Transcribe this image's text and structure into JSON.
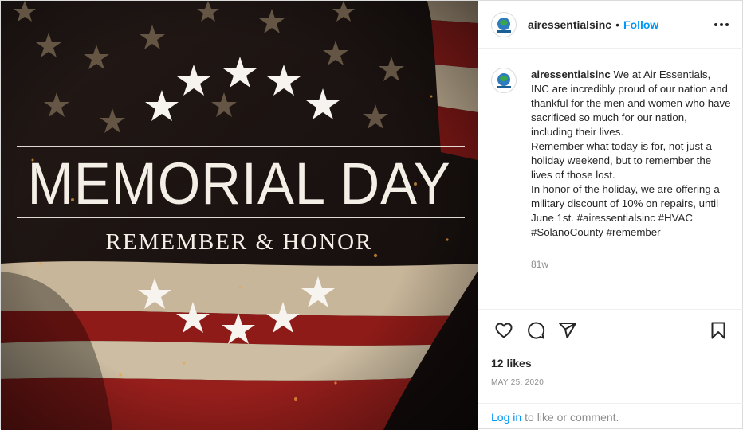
{
  "image": {
    "headline": "MEMORIAL DAY",
    "subline": "REMEMBER & HONOR",
    "colors": {
      "flag_red": "#9b1f1c",
      "flag_white": "#d8c9b0",
      "canton": "#1a1413",
      "text": "#f4efe6"
    }
  },
  "header": {
    "username": "airessentialsinc",
    "separator": "•",
    "follow_label": "Follow",
    "more_icon": "more-horizontal-icon"
  },
  "caption": {
    "username": "airessentialsinc",
    "text": " We at Air Essentials, INC are incredibly proud of our nation and thankful for the men and women who have sacrificed so much for our nation, including their lives.\nRemember what today is for, not just a holiday weekend, but to remember the lives of those lost.\nIn honor of the holiday, we are offering a military discount of 10% on repairs, until June 1st. #airessentialsinc #HVAC #SolanoCounty #remember",
    "age": "81w"
  },
  "actions": {
    "like_icon": "heart-icon",
    "comment_icon": "comment-icon",
    "share_icon": "paper-plane-icon",
    "save_icon": "bookmark-icon"
  },
  "likes": "12 likes",
  "date": "MAY 25, 2020",
  "login": {
    "link_label": "Log in",
    "rest": "to like or comment."
  },
  "accent": "#0095f6"
}
